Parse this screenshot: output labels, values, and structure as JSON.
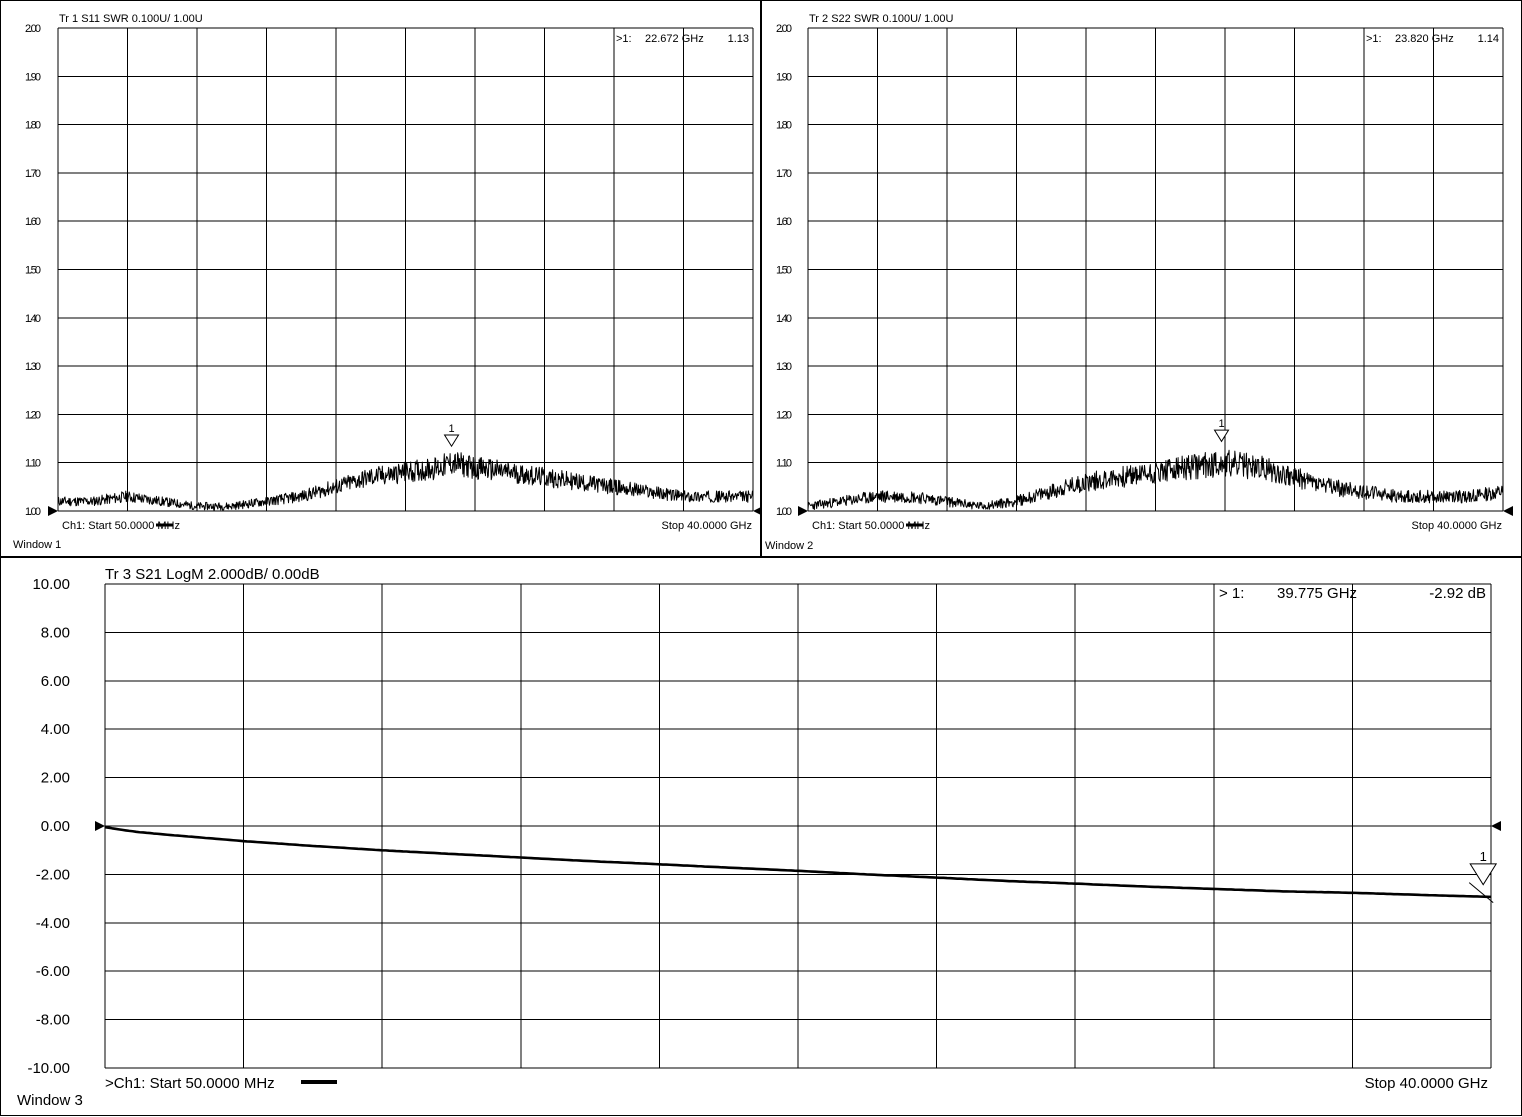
{
  "windows": [
    {
      "label": "Window 1",
      "title": "Tr 1  S11 SWR 0.100U/  1.00U",
      "marker": {
        "prefix": ">1:",
        "freq": "22.672  GHz",
        "value": "1.13",
        "id": "1"
      },
      "start_label": "Ch1:  Start  50.0000 MHz",
      "stop_label": "Stop  40.0000 GHz"
    },
    {
      "label": "Window 2",
      "title": "Tr 2  S22 SWR 0.100U/  1.00U",
      "marker": {
        "prefix": ">1:",
        "freq": "23.820  GHz",
        "value": "1.14",
        "id": "1"
      },
      "start_label": "Ch1:  Start  50.0000 MHz",
      "stop_label": "Stop  40.0000 GHz"
    },
    {
      "label": "Window 3",
      "title": "Tr  3   S21  LogM  2.000dB/   0.00dB",
      "marker": {
        "prefix": "> 1:",
        "freq": "39.775  GHz",
        "value": "-2.92  dB",
        "id": "1"
      },
      "start_label": ">Ch1:  Start   50.0000 MHz",
      "stop_label": "Stop  40.0000 GHz"
    }
  ],
  "chart_data": [
    {
      "type": "line",
      "title": "Tr 1  S11 SWR 0.100U/  1.00U",
      "x_range_ghz": [
        0.05,
        40
      ],
      "ylim": [
        1.0,
        2.0
      ],
      "yticks": [
        "2.00",
        "1.90",
        "1.80",
        "1.70",
        "1.60",
        "1.50",
        "1.40",
        "1.30",
        "1.20",
        "1.10",
        "1.00"
      ],
      "grid": true,
      "series": [
        {
          "x": [
            0.05,
            2,
            4,
            6,
            8,
            10,
            12,
            14,
            16,
            18,
            20,
            22,
            22.672,
            24,
            26,
            28,
            30,
            32,
            34,
            36,
            38,
            40
          ],
          "values": [
            1.02,
            1.02,
            1.03,
            1.02,
            1.01,
            1.01,
            1.02,
            1.03,
            1.05,
            1.07,
            1.08,
            1.09,
            1.1,
            1.09,
            1.08,
            1.07,
            1.06,
            1.05,
            1.04,
            1.03,
            1.03,
            1.03
          ]
        }
      ],
      "marker": {
        "x": 22.672,
        "y": 1.13
      }
    },
    {
      "type": "line",
      "title": "Tr 2  S22 SWR 0.100U/  1.00U",
      "x_range_ghz": [
        0.05,
        40
      ],
      "ylim": [
        1.0,
        2.0
      ],
      "yticks": [
        "2.00",
        "1.90",
        "1.80",
        "1.70",
        "1.60",
        "1.50",
        "1.40",
        "1.30",
        "1.20",
        "1.10",
        "1.00"
      ],
      "grid": true,
      "series": [
        {
          "x": [
            0.05,
            2,
            4,
            6,
            8,
            10,
            12,
            14,
            16,
            18,
            20,
            22,
            23.82,
            26,
            28,
            30,
            32,
            34,
            36,
            38,
            40
          ],
          "values": [
            1.01,
            1.02,
            1.03,
            1.03,
            1.02,
            1.01,
            1.02,
            1.04,
            1.06,
            1.07,
            1.08,
            1.09,
            1.1,
            1.09,
            1.07,
            1.05,
            1.04,
            1.03,
            1.03,
            1.03,
            1.04
          ]
        }
      ],
      "marker": {
        "x": 23.82,
        "y": 1.14
      }
    },
    {
      "type": "line",
      "title": "Tr  3   S21  LogM  2.000dB/   0.00dB",
      "x_range_ghz": [
        0.05,
        40
      ],
      "ylim": [
        -10,
        10
      ],
      "yticks": [
        "10.00",
        "8.00",
        "6.00",
        "4.00",
        "2.00",
        "0.00",
        "-2.00",
        "-4.00",
        "-6.00",
        "-8.00",
        "-10.00"
      ],
      "grid": true,
      "series": [
        {
          "x": [
            0.05,
            0.5,
            1,
            2,
            3,
            4,
            6,
            8,
            10,
            12,
            14,
            16,
            18,
            20,
            22,
            24,
            26,
            28,
            30,
            32,
            34,
            36,
            38,
            39.775,
            40
          ],
          "values": [
            -0.05,
            -0.15,
            -0.25,
            -0.38,
            -0.5,
            -0.62,
            -0.82,
            -1.0,
            -1.15,
            -1.3,
            -1.45,
            -1.58,
            -1.72,
            -1.85,
            -2.0,
            -2.13,
            -2.27,
            -2.38,
            -2.5,
            -2.6,
            -2.7,
            -2.76,
            -2.85,
            -2.92,
            -2.93
          ]
        }
      ],
      "marker": {
        "x": 39.775,
        "y": -2.92
      }
    }
  ]
}
